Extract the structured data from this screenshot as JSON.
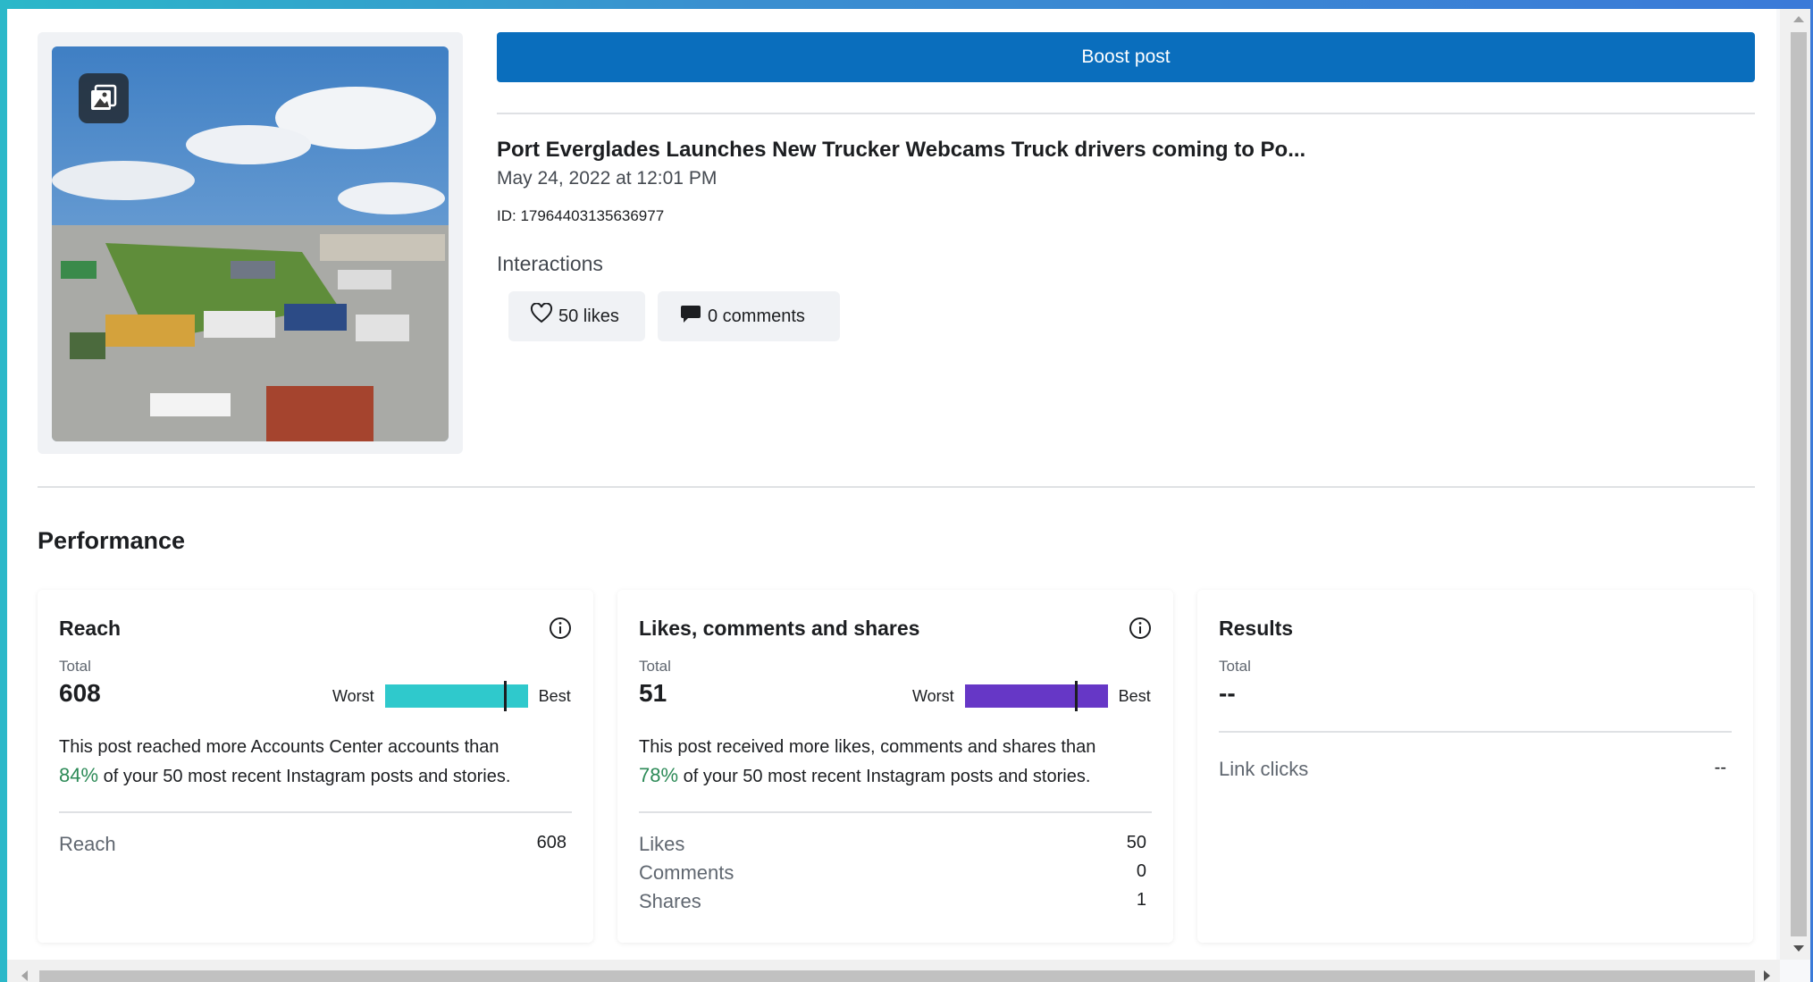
{
  "header": {
    "boost_label": "Boost post",
    "post_title": "Port Everglades Launches New Trucker Webcams Truck drivers coming to Po...",
    "post_date": "May 24, 2022 at 12:01 PM",
    "post_id": "ID: 17964403135636977"
  },
  "interactions": {
    "label": "Interactions",
    "likes": "50 likes",
    "comments": "0 comments"
  },
  "performance": {
    "title": "Performance",
    "reach": {
      "title": "Reach",
      "total_label": "Total",
      "total": "608",
      "worst": "Worst",
      "best": "Best",
      "bar_color": "#2fc9cc",
      "marker_fraction": 0.84,
      "desc_before": "This post reached more Accounts Center accounts than",
      "pct": "84%",
      "desc_after": "of your 50 most recent Instagram posts and stories.",
      "rows": [
        {
          "label": "Reach",
          "value": "608"
        }
      ]
    },
    "engagement": {
      "title": "Likes, comments and shares",
      "total_label": "Total",
      "total": "51",
      "worst": "Worst",
      "best": "Best",
      "bar_color": "#6637c6",
      "marker_fraction": 0.78,
      "desc_before": "This post received more likes, comments and shares than",
      "pct": "78%",
      "desc_after": "of your 50 most recent Instagram posts and stories.",
      "rows": [
        {
          "label": "Likes",
          "value": "50"
        },
        {
          "label": "Comments",
          "value": "0"
        },
        {
          "label": "Shares",
          "value": "1"
        }
      ]
    },
    "results": {
      "title": "Results",
      "total_label": "Total",
      "total": "--",
      "rows": [
        {
          "label": "Link clicks",
          "value": "--"
        }
      ]
    }
  },
  "colors": {
    "primary": "#0a6ebd",
    "positive": "#2c8a57"
  }
}
